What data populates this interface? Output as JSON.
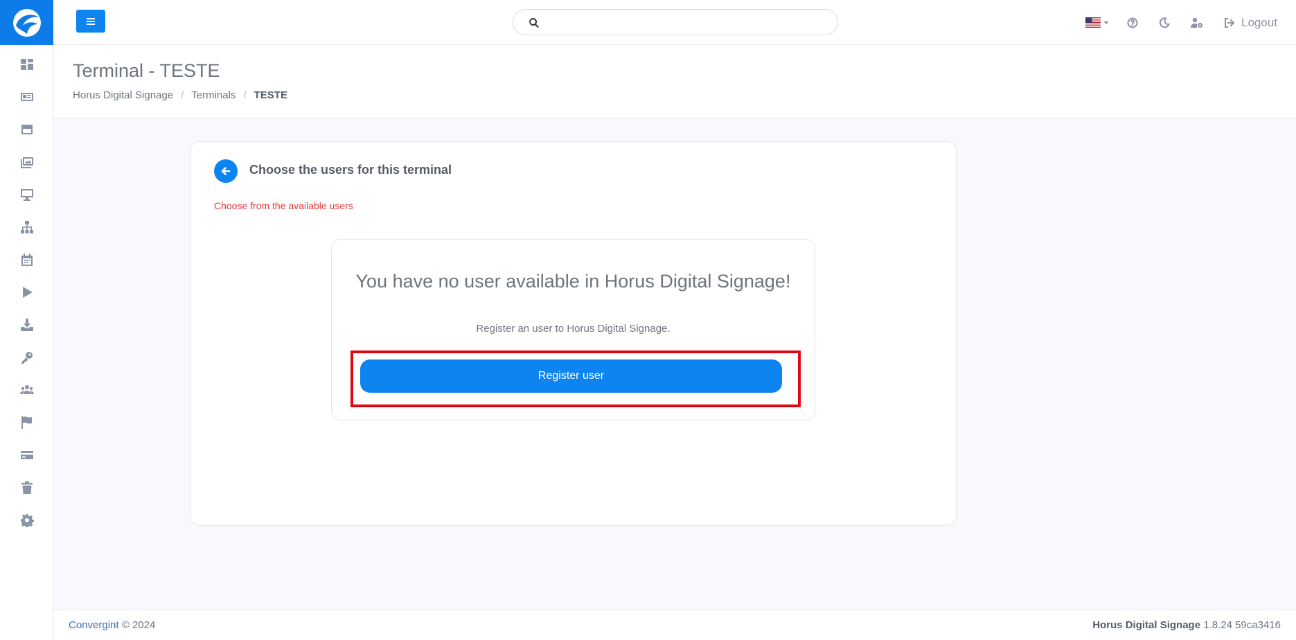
{
  "colors": {
    "accent": "#0d84f0",
    "logo_bg": "#0d7ce8",
    "subtitle_red": "#e5383b",
    "highlight_red": "#e30613"
  },
  "sidebar": {
    "items": [
      {
        "icon": "dashboard-icon"
      },
      {
        "icon": "id-card-icon"
      },
      {
        "icon": "layout-icon"
      },
      {
        "icon": "images-icon"
      },
      {
        "icon": "monitor-icon"
      },
      {
        "icon": "sitemap-icon"
      },
      {
        "icon": "calendar-icon"
      },
      {
        "icon": "play-icon"
      },
      {
        "icon": "download-icon"
      },
      {
        "icon": "key-icon"
      },
      {
        "icon": "users-icon"
      },
      {
        "icon": "flag-icon"
      },
      {
        "icon": "credit-card-icon"
      },
      {
        "icon": "trash-icon"
      },
      {
        "icon": "gear-icon"
      }
    ]
  },
  "topbar": {
    "search_placeholder": "",
    "search_value": "",
    "logout_label": "Logout"
  },
  "header": {
    "title": "Terminal - TESTE",
    "breadcrumb": [
      "Horus Digital Signage",
      "Terminals",
      "TESTE"
    ]
  },
  "card": {
    "title": "Choose the users for this terminal",
    "subtitle": "Choose from the available users",
    "empty_title": "You have no user available in Horus Digital Signage!",
    "empty_desc": "Register an user to Horus Digital Signage.",
    "register_label": "Register user"
  },
  "footer": {
    "company": "Convergint",
    "copyright": "© 2024",
    "product": "Horus Digital Signage",
    "version": "1.8.24 59ca3416"
  }
}
